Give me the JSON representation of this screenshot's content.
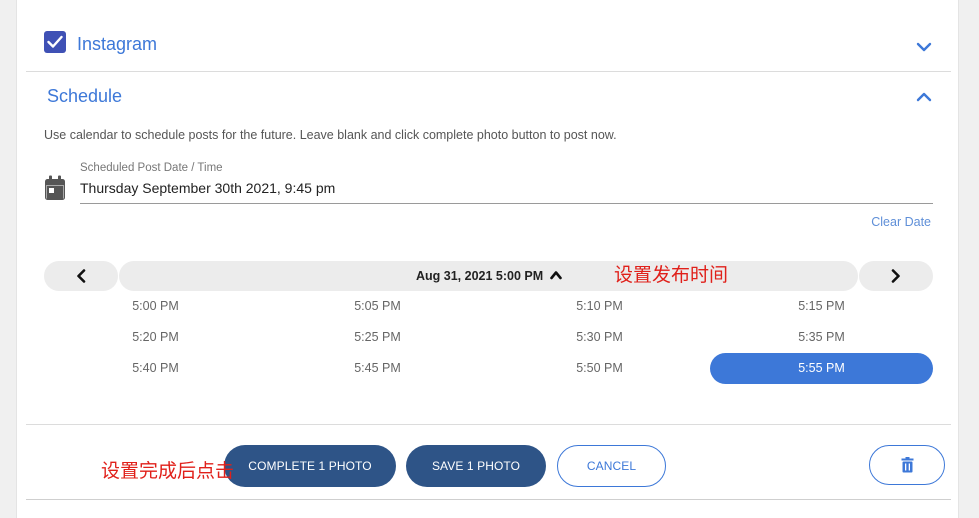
{
  "instagram": {
    "label": "Instagram",
    "checked": true
  },
  "schedule": {
    "label": "Schedule",
    "help_text": "Use calendar to schedule posts for the future. Leave blank and click complete photo button to post now.",
    "field_label": "Scheduled Post Date / Time",
    "field_value": "Thursday September 30th 2021, 9:45 pm",
    "clear_date": "Clear Date"
  },
  "picker": {
    "title": "Aug 31, 2021 5:00 PM",
    "times": [
      "5:00 PM",
      "5:05 PM",
      "5:10 PM",
      "5:15 PM",
      "5:20 PM",
      "5:25 PM",
      "5:30 PM",
      "5:35 PM",
      "5:40 PM",
      "5:45 PM",
      "5:50 PM",
      "5:55 PM"
    ],
    "selected": "5:55 PM"
  },
  "annotations": {
    "set_time": "设置发布时间",
    "click_after": "设置完成后点击"
  },
  "footer": {
    "complete_label": "COMPLETE 1 PHOTO",
    "save_label": "SAVE 1 PHOTO",
    "cancel_label": "CANCEL"
  },
  "colors": {
    "accent": "#3d78d8",
    "checkbox": "#3f51b5",
    "dark_button": "#2e5487",
    "annotation": "#e0201a"
  },
  "icons": [
    "check-icon",
    "chevron-down-icon",
    "chevron-up-icon",
    "calendar-icon",
    "chevron-left-icon",
    "chevron-right-icon",
    "caret-up-icon",
    "trash-icon"
  ]
}
